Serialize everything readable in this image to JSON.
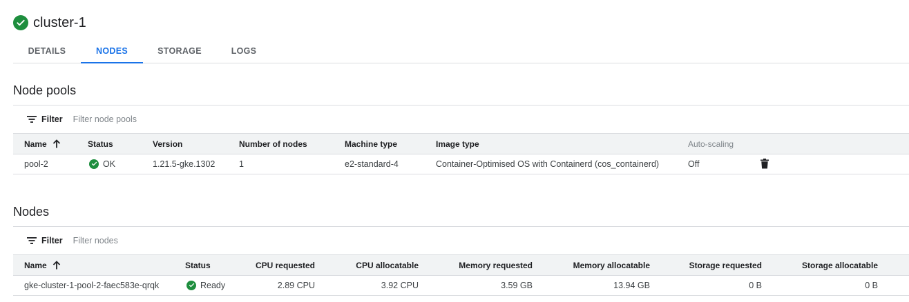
{
  "cluster": {
    "name": "cluster-1"
  },
  "tabs": [
    {
      "label": "DETAILS"
    },
    {
      "label": "NODES"
    },
    {
      "label": "STORAGE"
    },
    {
      "label": "LOGS"
    }
  ],
  "active_tab": "NODES",
  "node_pools": {
    "title": "Node pools",
    "filter_label": "Filter",
    "filter_placeholder": "Filter node pools",
    "columns": [
      "Name",
      "Status",
      "Version",
      "Number of nodes",
      "Machine type",
      "Image type",
      "Auto-scaling"
    ],
    "rows": [
      {
        "name": "pool-2",
        "status": "OK",
        "version": "1.21.5-gke.1302",
        "nodes": "1",
        "machine_type": "e2-standard-4",
        "image_type": "Container-Optimised OS with Containerd (cos_containerd)",
        "autoscaling": "Off"
      }
    ]
  },
  "nodes": {
    "title": "Nodes",
    "filter_label": "Filter",
    "filter_placeholder": "Filter nodes",
    "columns": [
      "Name",
      "Status",
      "CPU requested",
      "CPU allocatable",
      "Memory requested",
      "Memory allocatable",
      "Storage requested",
      "Storage allocatable"
    ],
    "rows": [
      {
        "name": "gke-cluster-1-pool-2-faec583e-qrqk",
        "status": "Ready",
        "cpu_requested": "2.89 CPU",
        "cpu_allocatable": "3.92 CPU",
        "memory_requested": "3.59 GB",
        "memory_allocatable": "13.94 GB",
        "storage_requested": "0 B",
        "storage_allocatable": "0 B"
      }
    ]
  },
  "icons": {
    "status_ok": "check-circle-icon",
    "sort": "arrow-up-icon",
    "filter": "filter-icon",
    "delete": "trash-icon"
  },
  "colors": {
    "accent": "#1a73e8",
    "success": "#1e8e3e",
    "header_bg": "#f1f3f4"
  }
}
